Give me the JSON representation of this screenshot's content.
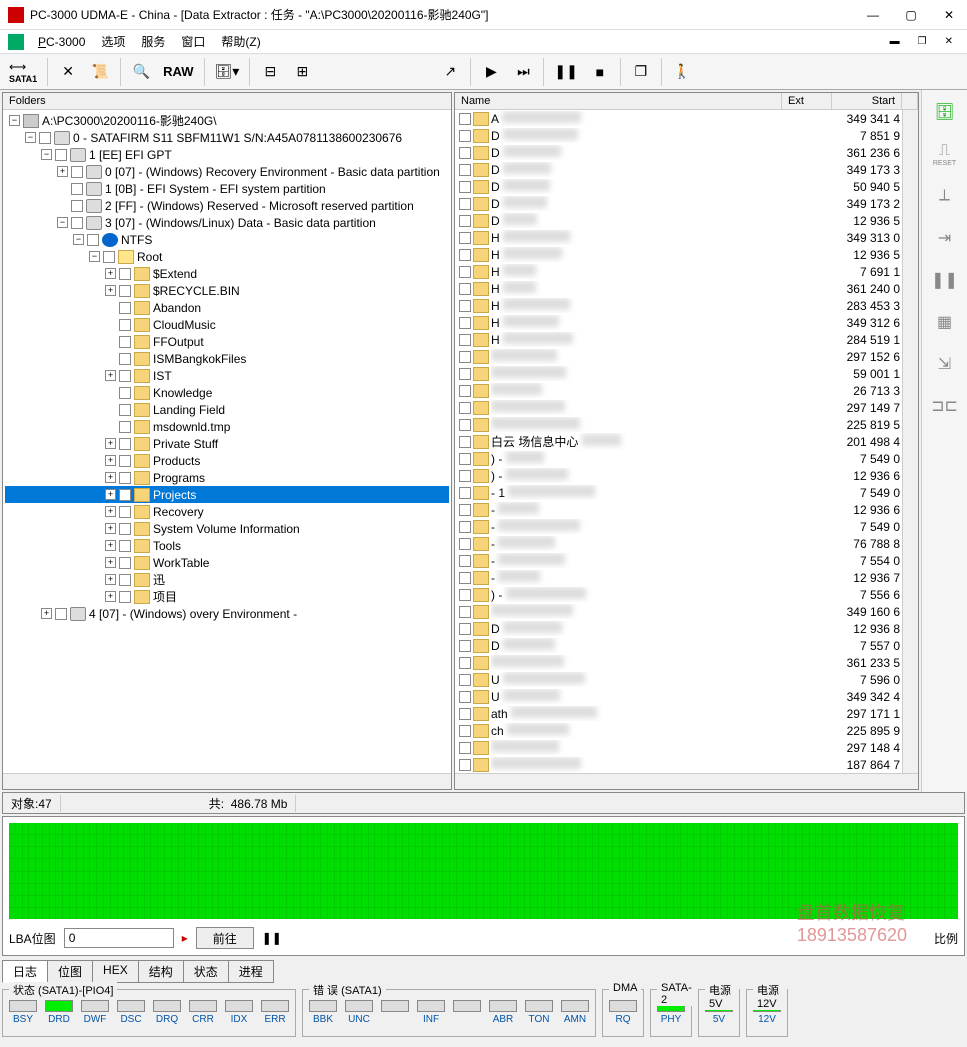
{
  "window": {
    "title": "PC-3000 UDMA-E - China - [Data Extractor : 任务 - \"A:\\PC3000\\20200116-影驰240G\"]"
  },
  "menu": {
    "app": "PC-3000",
    "items": [
      "选项",
      "服务",
      "窗口",
      "帮助(Z)"
    ]
  },
  "toolbar": {
    "sata": "SATA1",
    "raw": "RAW"
  },
  "left": {
    "title": "Folders",
    "root": "A:\\PC3000\\20200116-影驰240G\\",
    "disk": "0 - SATAFIRM   S11 SBFM11W1 S/N:A45A0781138600230676",
    "gpt": "1 [EE] EFI GPT",
    "parts": [
      "0 [07] - (Windows) Recovery Environment - Basic data partition",
      "1 [0B] - EFI System - EFI system partition",
      "2 [FF] - (Windows) Reserved - Microsoft reserved partition",
      "3 [07] - (Windows/Linux) Data - Basic data partition"
    ],
    "ntfs": "NTFS",
    "rootlbl": "Root",
    "folders": [
      "$Extend",
      "$RECYCLE.BIN",
      "Abandon",
      "CloudMusic",
      "FFOutput",
      "ISMBangkokFiles",
      "IST",
      "Knowledge",
      "Landing Field",
      "msdownld.tmp",
      "Private Stuff",
      "Products",
      "Programs",
      "Projects",
      "Recovery",
      "System Volume Information",
      "Tools",
      "WorkTable",
      "迅",
      "项目"
    ],
    "selected": "Projects",
    "part4": "4 [07] - (Windows)        overy Environment -"
  },
  "right": {
    "headers": {
      "name": "Name",
      "ext": "Ext",
      "start": "Start"
    },
    "rows": [
      {
        "n": "A",
        "s": "349 341 4"
      },
      {
        "n": "D",
        "s": "7 851 9"
      },
      {
        "n": "D",
        "s": "361 236 6"
      },
      {
        "n": "D",
        "s": "349 173 3"
      },
      {
        "n": "D",
        "s": "50 940 5"
      },
      {
        "n": "D",
        "s": "349 173 2"
      },
      {
        "n": "D",
        "s": "12 936 5"
      },
      {
        "n": "H",
        "s": "349 313 0"
      },
      {
        "n": "H",
        "s": "12 936 5"
      },
      {
        "n": "H",
        "s": "7 691 1"
      },
      {
        "n": "H",
        "s": "361 240 0"
      },
      {
        "n": "H",
        "s": "283 453 3"
      },
      {
        "n": "H",
        "s": "349 312 6"
      },
      {
        "n": "H",
        "s": "284 519 1"
      },
      {
        "n": "",
        "s": "297 152 6"
      },
      {
        "n": "",
        "s": "59 001 1"
      },
      {
        "n": "",
        "s": "26 713 3"
      },
      {
        "n": "",
        "s": "297 149 7"
      },
      {
        "n": "",
        "s": "225 819 5"
      },
      {
        "n": "白云    场信息中心",
        "s": "201 498 4"
      },
      {
        "n": ") -",
        "s": "7 549 0"
      },
      {
        "n": ") -",
        "s": "12 936 6"
      },
      {
        "n": "- 1",
        "s": "7 549 0"
      },
      {
        "n": "-",
        "s": "12 936 6"
      },
      {
        "n": "-",
        "s": "7 549 0"
      },
      {
        "n": "-",
        "s": "76 788 8"
      },
      {
        "n": "-",
        "s": "7 554 0"
      },
      {
        "n": "-",
        "s": "12 936 7"
      },
      {
        "n": ") -",
        "s": "7 556 6"
      },
      {
        "n": "",
        "s": "349 160 6"
      },
      {
        "n": "D",
        "s": "12 936 8"
      },
      {
        "n": "D",
        "s": "7 557 0"
      },
      {
        "n": "",
        "s": "361 233 5"
      },
      {
        "n": "U",
        "s": "7 596 0"
      },
      {
        "n": "U",
        "s": "349 342 4"
      },
      {
        "n": "ath",
        "s": "297 171 1"
      },
      {
        "n": "ch",
        "s": "225 895 9"
      },
      {
        "n": "",
        "s": "297 148 4"
      },
      {
        "n": "",
        "s": "187 864 7"
      }
    ]
  },
  "status": {
    "objects_label": "对象:",
    "objects": "47",
    "total_label": "共:",
    "total": "486.78 Mb"
  },
  "bitmap": {
    "label": "LBA位图",
    "value": "0",
    "goto": "前往",
    "ratio": "比例"
  },
  "watermark": {
    "line1": "盘首数据恢复",
    "line2": "18913587620"
  },
  "tabs": [
    "日志",
    "位图",
    "HEX",
    "结构",
    "状态",
    "进程"
  ],
  "active_tab": "日志",
  "hw": {
    "state": {
      "title": "状态 (SATA1)-[PIO4]",
      "leds": [
        "BSY",
        "DRD",
        "DWF",
        "DSC",
        "DRQ",
        "CRR",
        "IDX",
        "ERR"
      ],
      "on": [
        1
      ]
    },
    "err": {
      "title": "错 误 (SATA1)",
      "leds": [
        "BBK",
        "UNC",
        "",
        "INF",
        "",
        "ABR",
        "TON",
        "AMN"
      ]
    },
    "dma": {
      "title": "DMA",
      "leds": [
        "RQ"
      ]
    },
    "sata2": {
      "title": "SATA-2",
      "leds": [
        "PHY"
      ],
      "on": [
        0
      ]
    },
    "p5": {
      "title": "电源 5V",
      "leds": [
        "5V"
      ],
      "on": [
        0
      ]
    },
    "p12": {
      "title": "电源 12V",
      "leds": [
        "12V"
      ],
      "on": [
        0
      ]
    }
  }
}
